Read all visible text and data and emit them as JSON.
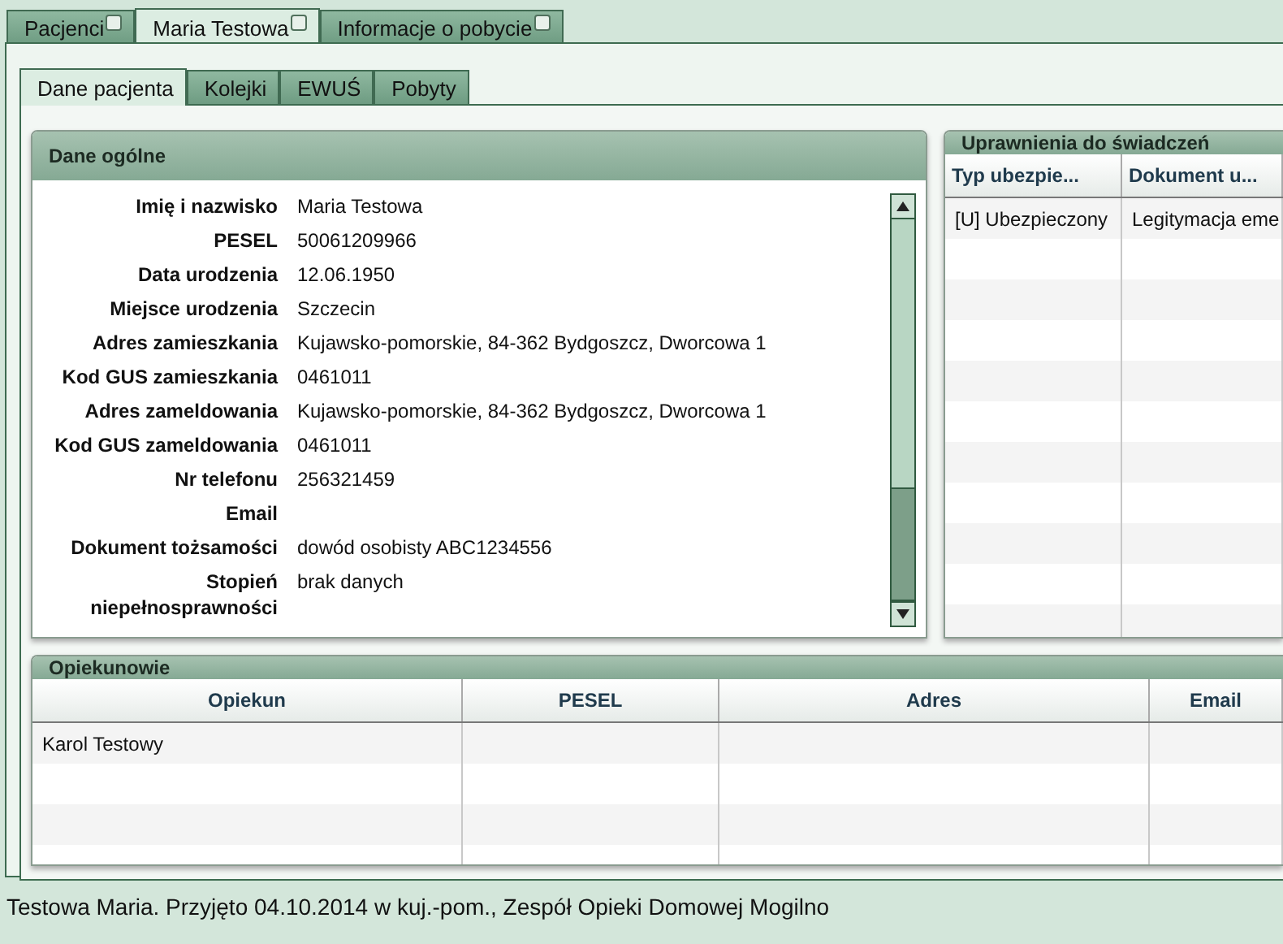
{
  "top_tabs": [
    {
      "label": "Pacjenci",
      "selected": false
    },
    {
      "label": "Maria Testowa",
      "selected": true
    },
    {
      "label": "Informacje o pobycie",
      "selected": false
    }
  ],
  "sub_tabs": [
    {
      "label": "Dane pacjenta",
      "selected": true
    },
    {
      "label": "Kolejki",
      "selected": false
    },
    {
      "label": "EWUŚ",
      "selected": false
    },
    {
      "label": "Pobyty",
      "selected": false
    }
  ],
  "general": {
    "title": "Dane ogólne",
    "fields": [
      {
        "label": "Imię i nazwisko",
        "value": "Maria Testowa"
      },
      {
        "label": "PESEL",
        "value": "50061209966"
      },
      {
        "label": "Data urodzenia",
        "value": "12.06.1950"
      },
      {
        "label": "Miejsce urodzenia",
        "value": "Szczecin"
      },
      {
        "label": "Adres zamieszkania",
        "value": "Kujawsko-pomorskie, 84-362 Bydgoszcz, Dworcowa 1"
      },
      {
        "label": "Kod GUS zamieszkania",
        "value": "0461011"
      },
      {
        "label": "Adres zameldowania",
        "value": "Kujawsko-pomorskie, 84-362 Bydgoszcz, Dworcowa 1"
      },
      {
        "label": "Kod GUS zameldowania",
        "value": "0461011"
      },
      {
        "label": "Nr telefonu",
        "value": "256321459"
      },
      {
        "label": "Email"
      },
      {
        "label": "Dokument tożsamości",
        "value": "dowód osobisty ABC1234556"
      },
      {
        "label": "Stopień niepełnosprawności",
        "value": "brak danych"
      }
    ]
  },
  "entitlements": {
    "title": "Uprawnienia do świadczeń",
    "columns": [
      "Typ ubezpie...",
      "Dokument u..."
    ],
    "rows": [
      [
        "[U] Ubezpieczony",
        "Legitymacja eme"
      ]
    ]
  },
  "guardians": {
    "title": "Opiekunowie",
    "columns": [
      "Opiekun",
      "PESEL",
      "Adres",
      "Email"
    ],
    "rows": [
      [
        "Karol Testowy",
        "",
        "",
        ""
      ]
    ]
  },
  "status_bar": "Testowa Maria. Przyjęto 04.10.2014 w kuj.-pom., Zespół Opieki Domowej Mogilno"
}
